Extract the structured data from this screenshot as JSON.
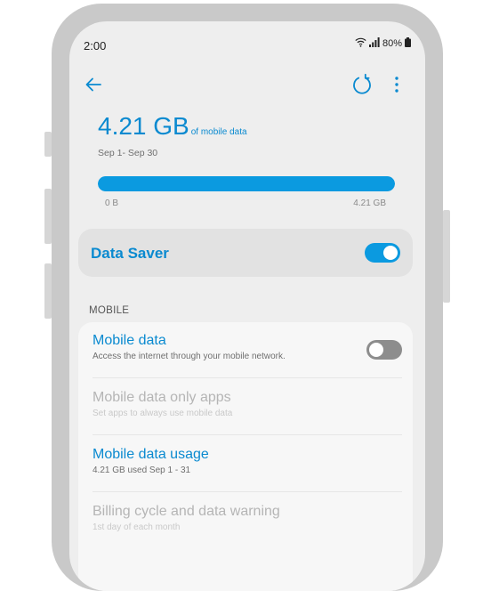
{
  "status_bar": {
    "time": "2:00",
    "battery": "80%"
  },
  "icons": {
    "back": "back-arrow-icon",
    "refresh": "refresh-icon",
    "more": "more-vert-icon",
    "wifi": "wifi-icon",
    "signal": "signal-icon",
    "battery": "battery-icon"
  },
  "usage": {
    "amount": "4.21 GB",
    "amount_suffix": "of mobile data",
    "period": "Sep 1- Sep 30",
    "bar_fill_fraction": 1.0,
    "bar_min_label": "0 B",
    "bar_max_label": "4.21 GB"
  },
  "data_saver": {
    "label": "Data Saver",
    "enabled": true
  },
  "section": {
    "header": "MOBILE"
  },
  "items": [
    {
      "title": "Mobile data",
      "subtitle": "Access the internet through your mobile network.",
      "toggle": false,
      "enabled": true
    },
    {
      "title": "Mobile data only apps",
      "subtitle": "Set apps to always use mobile data",
      "enabled": false
    },
    {
      "title": "Mobile data usage",
      "subtitle": "4.21 GB used Sep 1 - 31",
      "enabled": true
    },
    {
      "title": "Billing cycle and data warning",
      "subtitle": "1st day of each month",
      "enabled": false
    }
  ],
  "colors": {
    "accent": "#0a8ad0",
    "bar_fill": "#0b9ae0",
    "bar_track": "#c5e6f6",
    "toggle_off": "#8d8d8d",
    "disabled_text": "#b5b5b5"
  }
}
